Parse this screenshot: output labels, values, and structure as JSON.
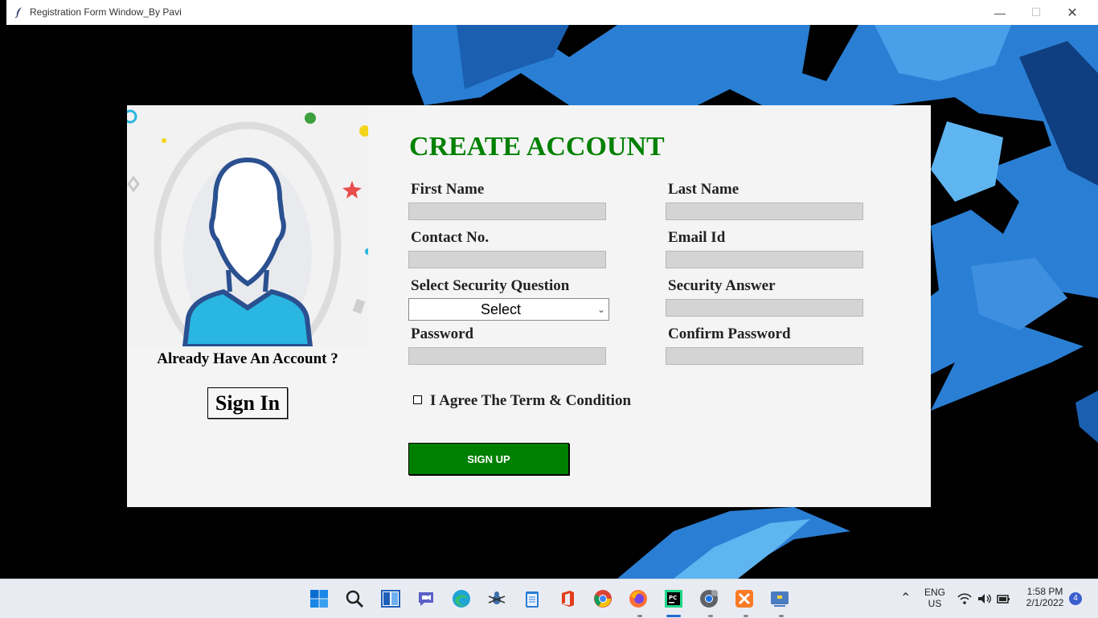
{
  "window": {
    "title": "Registration Form Window_By Pavi"
  },
  "left_panel": {
    "already_text": "Already Have An Account ?",
    "sign_in_label": "Sign In"
  },
  "form": {
    "heading": "CREATE ACCOUNT",
    "first_name_label": "First Name",
    "first_name_value": "",
    "last_name_label": "Last Name",
    "last_name_value": "",
    "contact_label": "Contact No.",
    "contact_value": "",
    "email_label": "Email Id",
    "email_value": "",
    "security_question_label": "Select Security Question",
    "security_question_selected": "Select",
    "security_answer_label": "Security Answer",
    "security_answer_value": "",
    "password_label": "Password",
    "password_value": "",
    "confirm_password_label": "Confirm Password",
    "confirm_password_value": "",
    "agree_label": "I Agree The Term & Condition",
    "agree_checked": false,
    "sign_up_label": "SIGN UP"
  },
  "colors": {
    "heading": "#008000",
    "sign_up_bg": "#008000",
    "input_bg": "#d4d4d4",
    "card_bg": "#f4f4f4"
  },
  "taskbar": {
    "apps": [
      "start-icon",
      "search-icon",
      "task-view-icon",
      "teams-chat-icon",
      "edge-icon",
      "bug-app-icon",
      "notepad-icon",
      "office-icon",
      "chrome-icon",
      "firefox-icon",
      "pycharm-icon",
      "chrome-canary-icon",
      "xampp-icon",
      "python-icon"
    ],
    "lang_line1": "ENG",
    "lang_line2": "US",
    "time": "1:58 PM",
    "date": "2/1/2022",
    "notification_count": "4"
  }
}
